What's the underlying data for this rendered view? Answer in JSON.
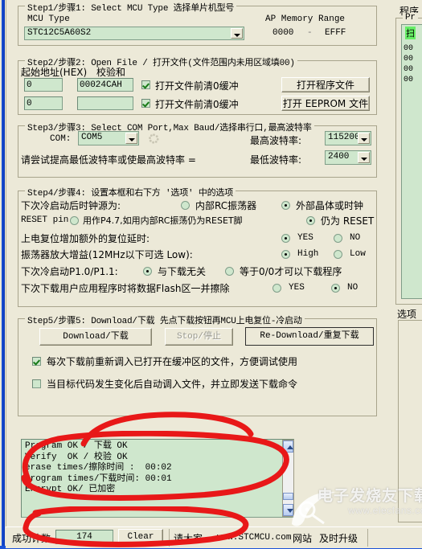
{
  "app": {
    "accent_blue": "#1a52d8",
    "panel_bg": "#ece9d8",
    "field_green": "#cfe7cd",
    "annotation_red": "#e81818"
  },
  "step1": {
    "caption": "Step1/步骤1: Select MCU Type  选择单片机型号",
    "mcu_type_label": "MCU Type",
    "mcu_type_value": "STC12C5A60S2",
    "ap_memory_range_label": "AP Memory Range",
    "range_start": "0000",
    "range_dash": "-",
    "range_end": "EFFF"
  },
  "step2": {
    "caption": "Step2/步骤2: Open File / 打开文件(文件范围内未用区域填00)",
    "start_address_label": "起始地址(HEX)",
    "checksum_label": "校验和",
    "row1": {
      "address_value": "0",
      "checksum_value": "00024CAH",
      "clear_buffer_label": "打开文件前清0缓冲",
      "clear_buffer_checked": true,
      "open_button": "打开程序文件"
    },
    "row2": {
      "address_value": "0",
      "checksum_value": "",
      "clear_buffer_label": "打开文件前清0缓冲",
      "clear_buffer_checked": true,
      "open_button": "打开 EEPROM 文件"
    }
  },
  "step3": {
    "caption": "Step3/步骤3: Select COM Port,Max Baud/选择串行口,最高波特率",
    "com_label": "COM:",
    "com_value": "COM5",
    "max_baud_label": "最高波特率:",
    "max_baud_value": "115200",
    "hint_text": "请尝试提高最低波特率或使最高波特率 =",
    "min_baud_label": "最低波特率:",
    "min_baud_value": "2400"
  },
  "step4": {
    "caption": "Step4/步骤4: 设置本框和右下方 '选项' 中的选项",
    "rows": [
      {
        "label": "下次冷启动后时钟源为:",
        "options": [
          {
            "text": "内部RC振荡器",
            "selected": false
          },
          {
            "text": "外部晶体或时钟",
            "selected": true
          }
        ]
      },
      {
        "label": "RESET pin",
        "options": [
          {
            "text": "用作P4.7,如用内部RC振荡仍为RESET脚",
            "selected": false
          },
          {
            "text": "仍为 RESET",
            "selected": true
          }
        ]
      },
      {
        "label": "上电复位增加额外的复位延时:",
        "options": [
          {
            "text": "YES",
            "selected": true
          },
          {
            "text": "NO",
            "selected": false
          }
        ]
      },
      {
        "label": "振荡器放大增益(12MHz以下可选 Low):",
        "options": [
          {
            "text": "High",
            "selected": true
          },
          {
            "text": "Low",
            "selected": false
          }
        ]
      },
      {
        "label": "下次冷启动P1.0/P1.1:",
        "options": [
          {
            "text": "与下载无关",
            "selected": true
          },
          {
            "text": "等于0/0才可以下载程序",
            "selected": false
          }
        ]
      },
      {
        "label": "下次下载用户应用程序时将数据Flash区一并擦除",
        "options": [
          {
            "text": "YES",
            "selected": false
          },
          {
            "text": "NO",
            "selected": true
          }
        ]
      }
    ]
  },
  "step5": {
    "caption": "Step5/步骤5: Download/下载  先点下载按钮再MCU上电复位-冷启动",
    "download_button": "Download/下载",
    "stop_button": "Stop/停止",
    "stop_disabled": true,
    "redownload_button": "Re-Download/重复下载",
    "check_reload": {
      "label": "每次下载前重新调入已打开在缓冲区的文件，方便调试使用",
      "checked": true
    },
    "check_autoload": {
      "label": "当目标代码发生变化后自动调入文件，并立即发送下载命令",
      "checked": false
    }
  },
  "log": {
    "lines": [
      "Program OK / 下载 OK",
      "Verify  OK / 校验 OK",
      "erase times/擦除时间 :  00:02",
      "program times/下载时间: 00:01",
      "Encrypt OK/ 已加密"
    ]
  },
  "statusbar": {
    "success_count_label": "成功计数",
    "success_count_value": "174",
    "clear_button": "Clear",
    "notice_text": "请大家",
    "site_text": "www.STCMCU.com",
    "notice_tail": "网站",
    "notice_tail2": "及时升级"
  },
  "right_panel": {
    "title": "程序",
    "group_caption": "Pr",
    "selected_cell": "扫",
    "hex_rows": [
      "00",
      "00",
      "00",
      "00"
    ],
    "options_title": "选项"
  },
  "watermark": {
    "main_text": "电子发烧友下载",
    "sub_text": "www.elecfans.com"
  },
  "icons": {
    "dropdown": "chevron-down-icon",
    "scroll_up": "scroll-up-icon",
    "scroll_down": "scroll-down-icon",
    "refresh": "refresh-dots-icon",
    "checkmark": "check-icon"
  }
}
